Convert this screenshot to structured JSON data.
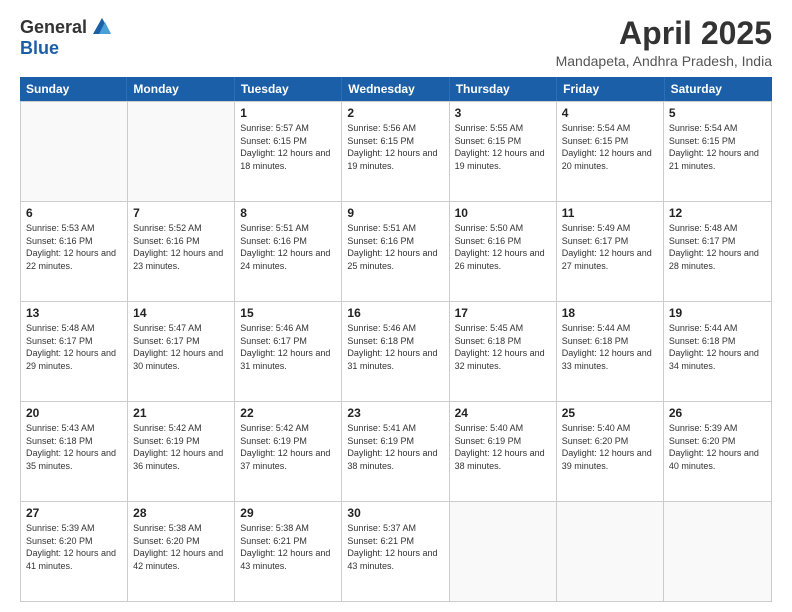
{
  "header": {
    "logo_general": "General",
    "logo_blue": "Blue",
    "title": "April 2025",
    "subtitle": "Mandapeta, Andhra Pradesh, India"
  },
  "weekdays": [
    "Sunday",
    "Monday",
    "Tuesday",
    "Wednesday",
    "Thursday",
    "Friday",
    "Saturday"
  ],
  "weeks": [
    [
      {
        "day": "",
        "info": ""
      },
      {
        "day": "",
        "info": ""
      },
      {
        "day": "1",
        "info": "Sunrise: 5:57 AM\nSunset: 6:15 PM\nDaylight: 12 hours and 18 minutes."
      },
      {
        "day": "2",
        "info": "Sunrise: 5:56 AM\nSunset: 6:15 PM\nDaylight: 12 hours and 19 minutes."
      },
      {
        "day": "3",
        "info": "Sunrise: 5:55 AM\nSunset: 6:15 PM\nDaylight: 12 hours and 19 minutes."
      },
      {
        "day": "4",
        "info": "Sunrise: 5:54 AM\nSunset: 6:15 PM\nDaylight: 12 hours and 20 minutes."
      },
      {
        "day": "5",
        "info": "Sunrise: 5:54 AM\nSunset: 6:15 PM\nDaylight: 12 hours and 21 minutes."
      }
    ],
    [
      {
        "day": "6",
        "info": "Sunrise: 5:53 AM\nSunset: 6:16 PM\nDaylight: 12 hours and 22 minutes."
      },
      {
        "day": "7",
        "info": "Sunrise: 5:52 AM\nSunset: 6:16 PM\nDaylight: 12 hours and 23 minutes."
      },
      {
        "day": "8",
        "info": "Sunrise: 5:51 AM\nSunset: 6:16 PM\nDaylight: 12 hours and 24 minutes."
      },
      {
        "day": "9",
        "info": "Sunrise: 5:51 AM\nSunset: 6:16 PM\nDaylight: 12 hours and 25 minutes."
      },
      {
        "day": "10",
        "info": "Sunrise: 5:50 AM\nSunset: 6:16 PM\nDaylight: 12 hours and 26 minutes."
      },
      {
        "day": "11",
        "info": "Sunrise: 5:49 AM\nSunset: 6:17 PM\nDaylight: 12 hours and 27 minutes."
      },
      {
        "day": "12",
        "info": "Sunrise: 5:48 AM\nSunset: 6:17 PM\nDaylight: 12 hours and 28 minutes."
      }
    ],
    [
      {
        "day": "13",
        "info": "Sunrise: 5:48 AM\nSunset: 6:17 PM\nDaylight: 12 hours and 29 minutes."
      },
      {
        "day": "14",
        "info": "Sunrise: 5:47 AM\nSunset: 6:17 PM\nDaylight: 12 hours and 30 minutes."
      },
      {
        "day": "15",
        "info": "Sunrise: 5:46 AM\nSunset: 6:17 PM\nDaylight: 12 hours and 31 minutes."
      },
      {
        "day": "16",
        "info": "Sunrise: 5:46 AM\nSunset: 6:18 PM\nDaylight: 12 hours and 31 minutes."
      },
      {
        "day": "17",
        "info": "Sunrise: 5:45 AM\nSunset: 6:18 PM\nDaylight: 12 hours and 32 minutes."
      },
      {
        "day": "18",
        "info": "Sunrise: 5:44 AM\nSunset: 6:18 PM\nDaylight: 12 hours and 33 minutes."
      },
      {
        "day": "19",
        "info": "Sunrise: 5:44 AM\nSunset: 6:18 PM\nDaylight: 12 hours and 34 minutes."
      }
    ],
    [
      {
        "day": "20",
        "info": "Sunrise: 5:43 AM\nSunset: 6:18 PM\nDaylight: 12 hours and 35 minutes."
      },
      {
        "day": "21",
        "info": "Sunrise: 5:42 AM\nSunset: 6:19 PM\nDaylight: 12 hours and 36 minutes."
      },
      {
        "day": "22",
        "info": "Sunrise: 5:42 AM\nSunset: 6:19 PM\nDaylight: 12 hours and 37 minutes."
      },
      {
        "day": "23",
        "info": "Sunrise: 5:41 AM\nSunset: 6:19 PM\nDaylight: 12 hours and 38 minutes."
      },
      {
        "day": "24",
        "info": "Sunrise: 5:40 AM\nSunset: 6:19 PM\nDaylight: 12 hours and 38 minutes."
      },
      {
        "day": "25",
        "info": "Sunrise: 5:40 AM\nSunset: 6:20 PM\nDaylight: 12 hours and 39 minutes."
      },
      {
        "day": "26",
        "info": "Sunrise: 5:39 AM\nSunset: 6:20 PM\nDaylight: 12 hours and 40 minutes."
      }
    ],
    [
      {
        "day": "27",
        "info": "Sunrise: 5:39 AM\nSunset: 6:20 PM\nDaylight: 12 hours and 41 minutes."
      },
      {
        "day": "28",
        "info": "Sunrise: 5:38 AM\nSunset: 6:20 PM\nDaylight: 12 hours and 42 minutes."
      },
      {
        "day": "29",
        "info": "Sunrise: 5:38 AM\nSunset: 6:21 PM\nDaylight: 12 hours and 43 minutes."
      },
      {
        "day": "30",
        "info": "Sunrise: 5:37 AM\nSunset: 6:21 PM\nDaylight: 12 hours and 43 minutes."
      },
      {
        "day": "",
        "info": ""
      },
      {
        "day": "",
        "info": ""
      },
      {
        "day": "",
        "info": ""
      }
    ]
  ]
}
